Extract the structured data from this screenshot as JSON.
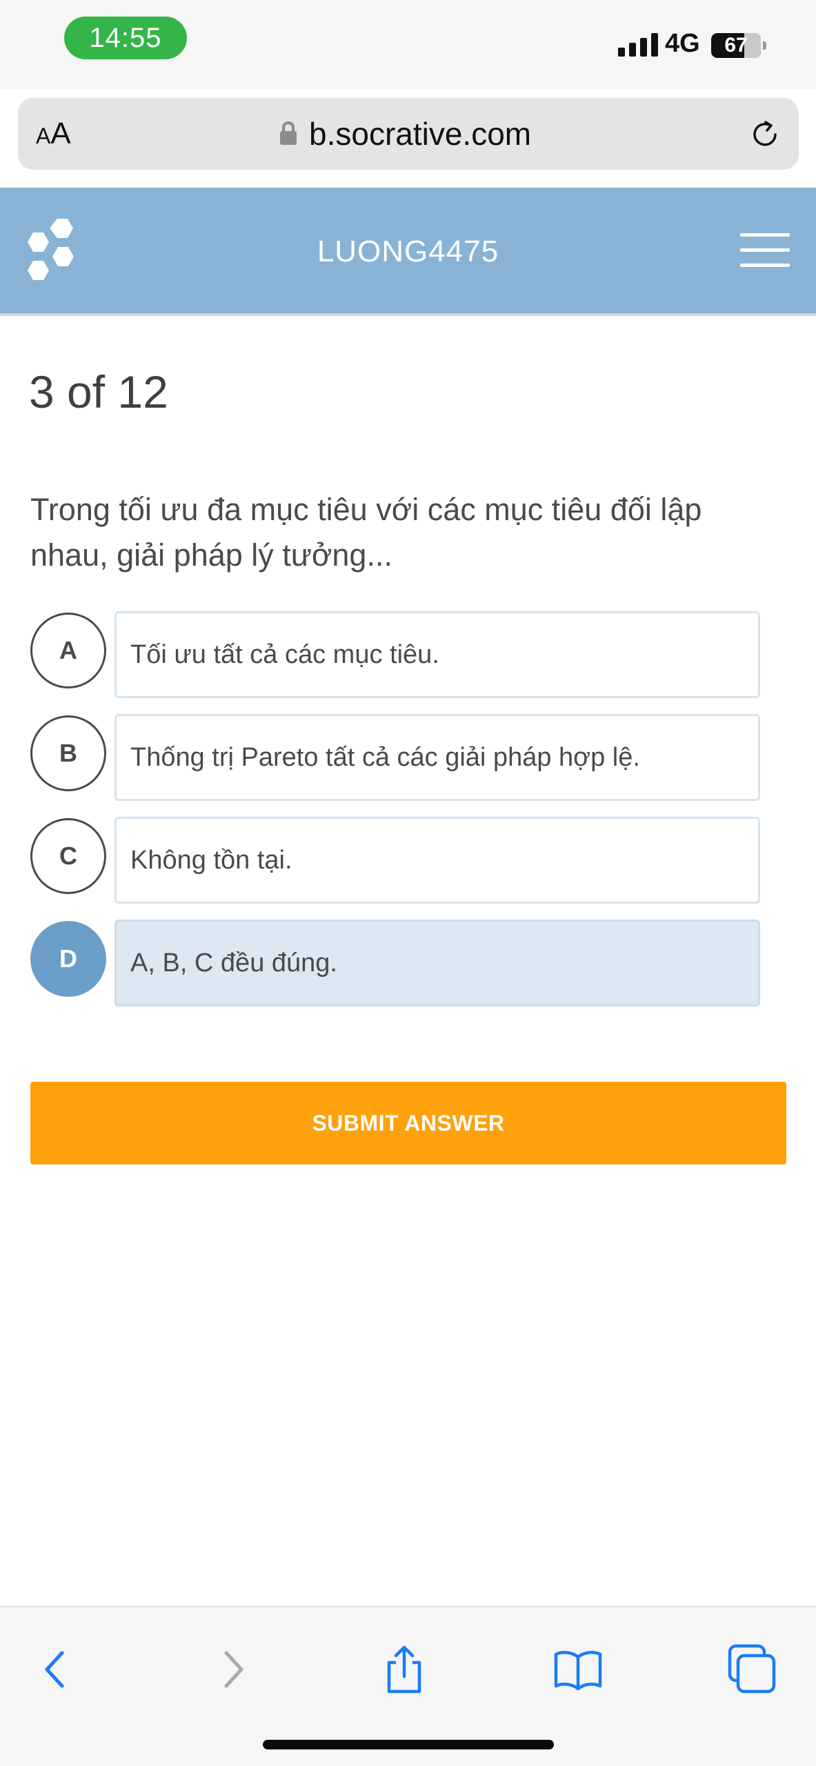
{
  "status_bar": {
    "time": "14:55",
    "network": "4G",
    "battery_level": "67",
    "battery_fraction": 0.67
  },
  "browser": {
    "text_size_small": "A",
    "text_size_large": "A",
    "url": "b.socrative.com"
  },
  "header": {
    "room_name": "LUONG4475"
  },
  "quiz": {
    "progress": "3 of 12",
    "question": "Trong tối ưu đa mục tiêu với các mục tiêu đối lập nhau, giải pháp lý tưởng...",
    "answers": [
      {
        "letter": "A",
        "text": "Tối ưu tất cả các mục tiêu.",
        "selected": false
      },
      {
        "letter": "B",
        "text": "Thống trị Pareto tất cả các giải pháp hợp lệ.",
        "selected": false
      },
      {
        "letter": "C",
        "text": "Không tồn tại.",
        "selected": false
      },
      {
        "letter": "D",
        "text": "A, B, C đều đúng.",
        "selected": true
      }
    ],
    "submit_label": "SUBMIT ANSWER"
  },
  "icons": {
    "logo": "socrative-hexagon-logo",
    "menu": "hamburger-menu-icon",
    "lock": "lock-icon",
    "reload": "reload-icon",
    "back": "chevron-left-icon",
    "forward": "chevron-right-icon",
    "share": "share-icon",
    "bookmarks": "book-icon",
    "tabs": "tabs-icon"
  },
  "colors": {
    "header": "#89b3d5",
    "selected_circle": "#6a9ec8",
    "selected_box": "#dce8f2",
    "submit": "#ffa10b",
    "time_pill": "#34b54a",
    "toolbar_accent": "#1a7cf4"
  }
}
